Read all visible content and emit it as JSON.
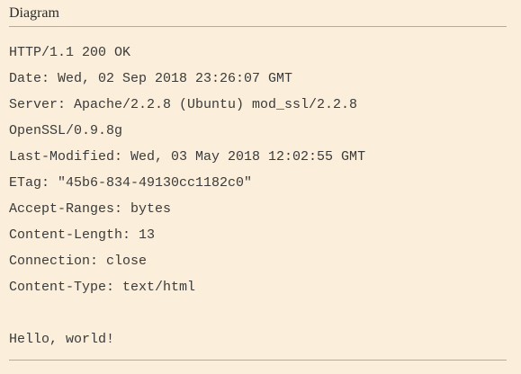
{
  "caption": "Diagram",
  "headers": [
    "HTTP/1.1 200 OK",
    "Date: Wed, 02 Sep 2018 23:26:07 GMT",
    "Server: Apache/2.2.8 (Ubuntu) mod_ssl/2.2.8",
    "OpenSSL/0.9.8g",
    "Last-Modified: Wed, 03 May 2018 12:02:55 GMT",
    "ETag: \"45b6-834-49130cc1182c0\"",
    "Accept-Ranges: bytes",
    "Content-Length: 13",
    "Connection: close",
    "Content-Type: text/html"
  ],
  "body_text": "Hello, world!",
  "colors": {
    "background": "#fbefdb",
    "rule": "#b9aa95",
    "text": "#3a3a3a"
  }
}
